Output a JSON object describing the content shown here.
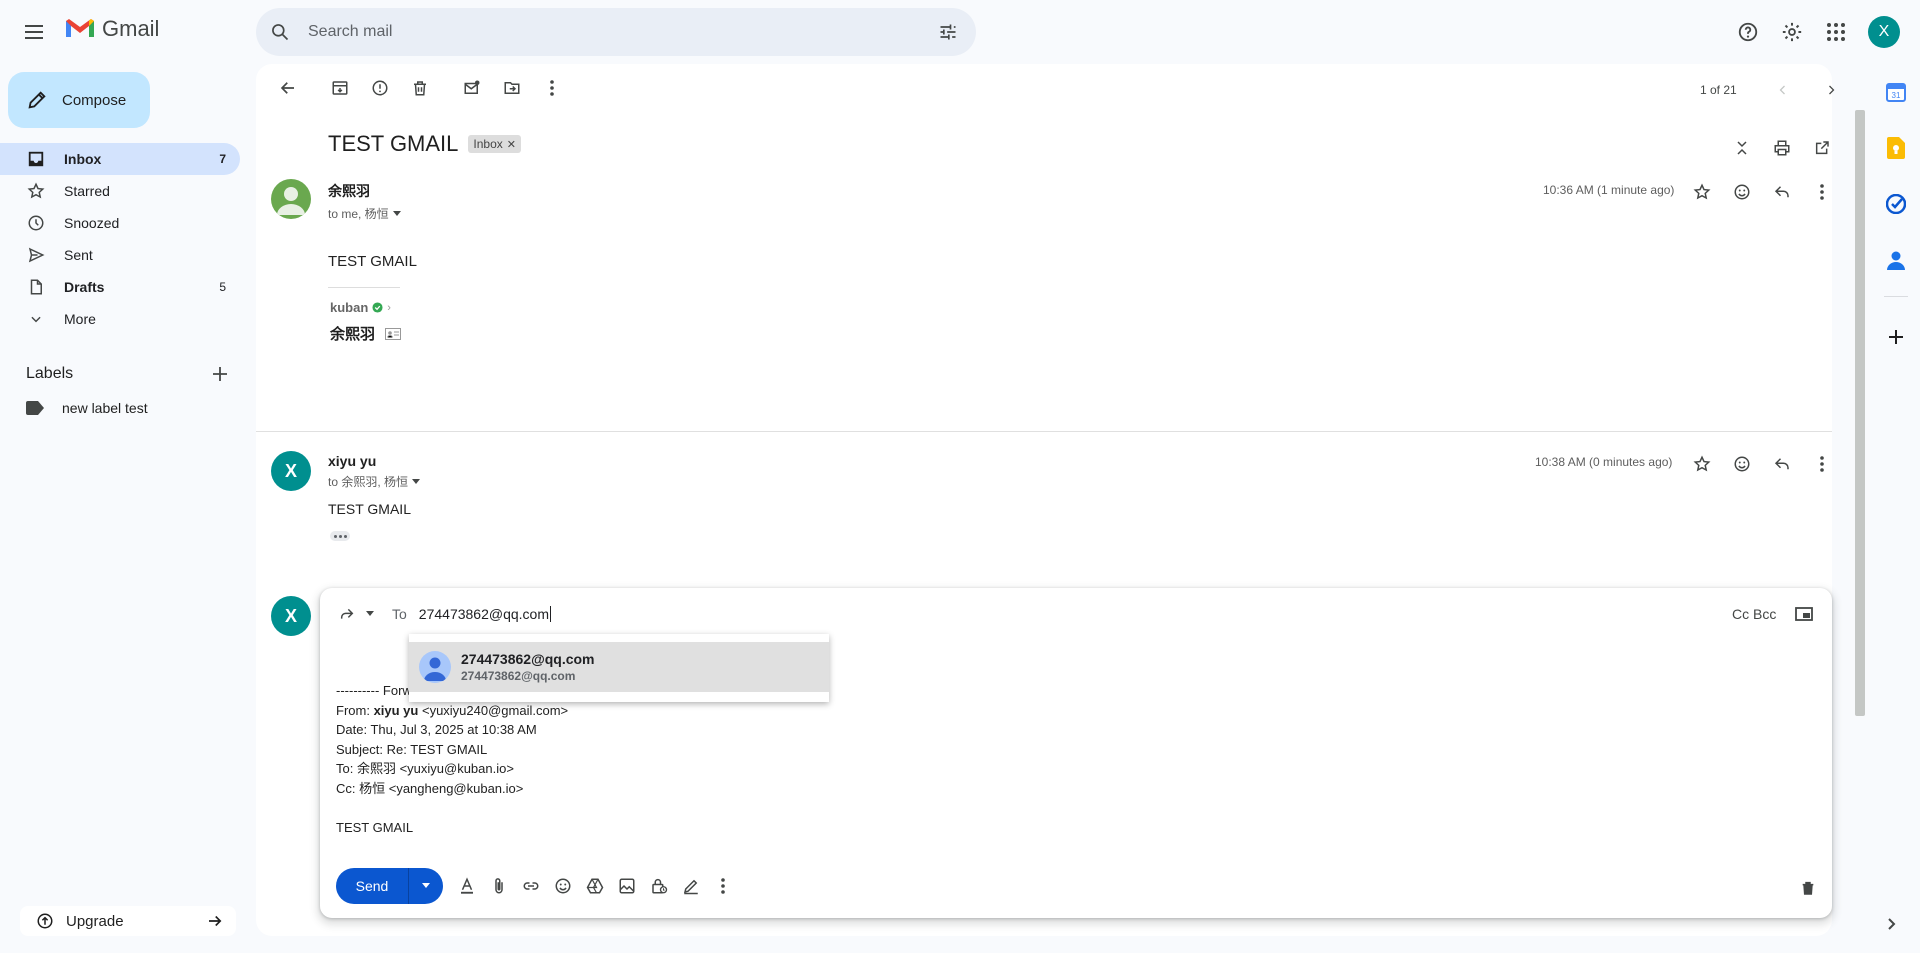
{
  "app": {
    "name": "Gmail"
  },
  "search": {
    "placeholder": "Search mail"
  },
  "header": {
    "account_initial": "X"
  },
  "compose": {
    "label": "Compose"
  },
  "nav": {
    "items": [
      {
        "label": "Inbox",
        "count": "7",
        "icon": "inbox-icon"
      },
      {
        "label": "Starred",
        "count": "",
        "icon": "star-icon"
      },
      {
        "label": "Snoozed",
        "count": "",
        "icon": "clock-icon"
      },
      {
        "label": "Sent",
        "count": "",
        "icon": "send-icon"
      },
      {
        "label": "Drafts",
        "count": "5",
        "icon": "draft-icon"
      },
      {
        "label": "More",
        "count": "",
        "icon": "chevron-down-icon"
      }
    ]
  },
  "labels": {
    "title": "Labels",
    "items": [
      {
        "label": "new label test"
      }
    ]
  },
  "upgrade": {
    "label": "Upgrade"
  },
  "pager": {
    "text": "1 of 21"
  },
  "thread": {
    "subject": "TEST GMAIL",
    "chip": "Inbox",
    "messages": [
      {
        "sender": "余熙羽",
        "to": "to me, 杨恒",
        "time": "10:36 AM (1 minute ago)",
        "body": "TEST GMAIL",
        "signature_company": "kuban",
        "signature_name": "余熙羽"
      },
      {
        "sender": "xiyu yu",
        "initial": "X",
        "to": "to 余熙羽, 杨恒",
        "time": "10:38 AM (0 minutes ago)",
        "body": "TEST GMAIL"
      }
    ]
  },
  "reply": {
    "initial": "X",
    "to_label": "To",
    "to_value": "274473862@qq.com",
    "cc_bcc": "Cc Bcc",
    "forwarded_header": "---------- Forw",
    "from_prefix": "From: ",
    "from_name": "xiyu yu",
    "from_email": " <yuxiyu240@gmail.com>",
    "date": "Date: Thu, Jul 3, 2025 at 10:38 AM",
    "subject": "Subject: Re: TEST GMAIL",
    "to": "To: 余熙羽 <yuxiyu@kuban.io>",
    "cc": "Cc: 杨恒 <yangheng@kuban.io>",
    "body": "TEST GMAIL",
    "send_label": "Send"
  },
  "suggestion": {
    "name": "274473862@qq.com",
    "email": "274473862@qq.com"
  },
  "colors": {
    "accent": "#0b57d0",
    "compose_bg": "#c2e7ff",
    "nav_active": "#d3e3fd",
    "avatar_teal": "#008f8f"
  }
}
